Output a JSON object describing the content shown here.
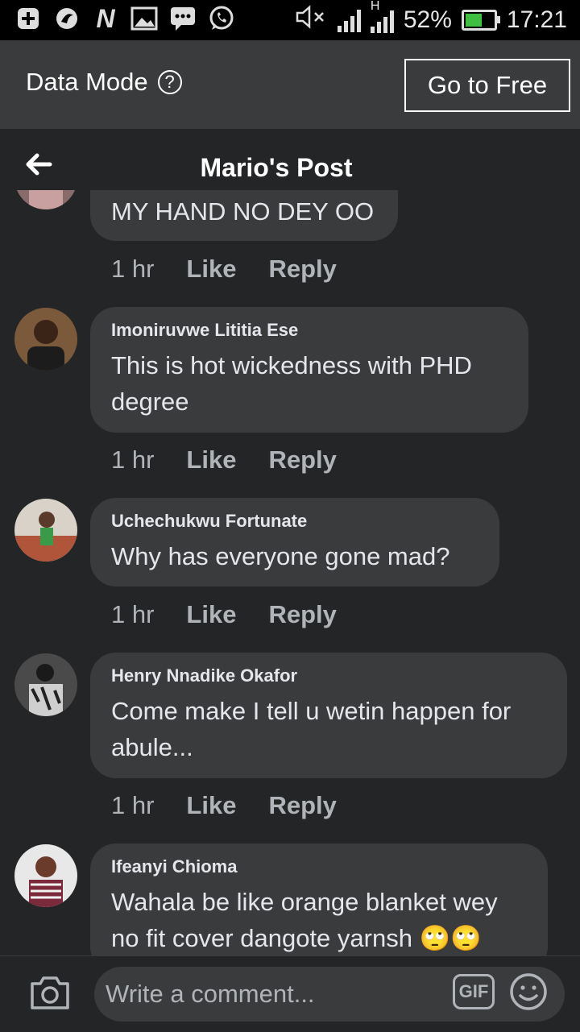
{
  "status_bar": {
    "battery": "52%",
    "time": "17:21",
    "network": "H",
    "battery_level": 0.52,
    "icons": [
      "add-icon",
      "app-icon",
      "n-icon",
      "gallery-icon",
      "message-icon",
      "whatsapp-icon",
      "mute-icon",
      "signal-icon",
      "battery-icon"
    ]
  },
  "data_mode": {
    "label": "Data Mode",
    "help_symbol": "?",
    "go_free_label": "Go to Free"
  },
  "header": {
    "title": "Mario's Post"
  },
  "comments": [
    {
      "author": "",
      "text": "MY HAND NO DEY OO",
      "time": "1 hr",
      "like": "Like",
      "reply": "Reply"
    },
    {
      "author": "Imoniruvwe Lititia Ese",
      "text": "This is hot wickedness with PHD degree",
      "time": "1 hr",
      "like": "Like",
      "reply": "Reply"
    },
    {
      "author": "Uchechukwu Fortunate",
      "text": "Why has everyone gone mad?",
      "time": "1 hr",
      "like": "Like",
      "reply": "Reply"
    },
    {
      "author": "Henry Nnadike Okafor",
      "text": "Come make I tell u wetin happen for abule...",
      "time": "1 hr",
      "like": "Like",
      "reply": "Reply"
    },
    {
      "author": "Ifeanyi Chioma",
      "text": "Wahala be like orange blanket wey no fit cover dangote yarnsh",
      "emoji": "🙄🙄"
    }
  ],
  "composer": {
    "placeholder": "Write a comment...",
    "gif_label": "GIF"
  },
  "colors": {
    "background": "#242526",
    "bubble": "#3a3b3c",
    "text": "#e4e6eb",
    "muted": "#b0b3b8",
    "battery": "#3fbf3f"
  }
}
